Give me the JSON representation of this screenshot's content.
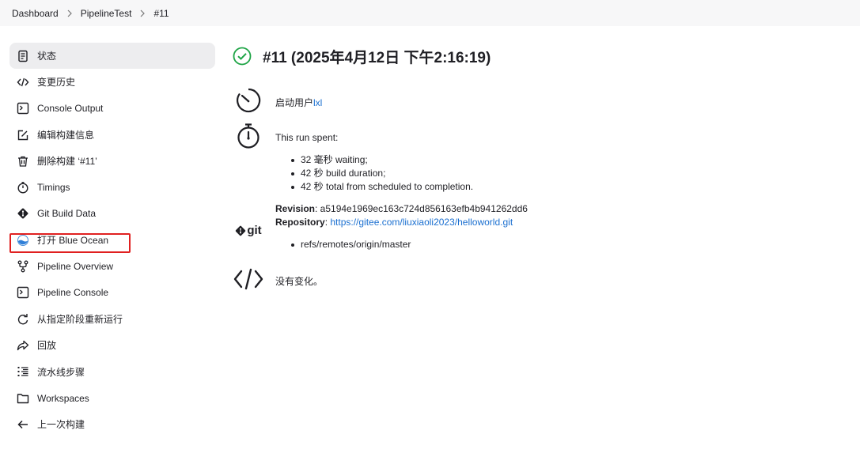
{
  "breadcrumb": {
    "items": [
      "Dashboard",
      "PipelineTest",
      "#11"
    ]
  },
  "sidebar": {
    "items": [
      {
        "label": "状态",
        "icon": "status-doc-icon"
      },
      {
        "label": "变更历史",
        "icon": "code-icon"
      },
      {
        "label": "Console Output",
        "icon": "terminal-icon"
      },
      {
        "label": "编辑构建信息",
        "icon": "edit-icon"
      },
      {
        "label": "删除构建 ‘#11’",
        "icon": "trash-icon"
      },
      {
        "label": "Timings",
        "icon": "stopwatch-icon"
      },
      {
        "label": "Git Build Data",
        "icon": "git-icon"
      },
      {
        "label": "打开 Blue Ocean",
        "icon": "blue-ocean-icon"
      },
      {
        "label": "Pipeline Overview",
        "icon": "pipeline-branch-icon"
      },
      {
        "label": "Pipeline Console",
        "icon": "terminal-icon"
      },
      {
        "label": "从指定阶段重新运行",
        "icon": "restart-icon"
      },
      {
        "label": "回放",
        "icon": "replay-icon"
      },
      {
        "label": "流水线步骤",
        "icon": "list-steps-icon"
      },
      {
        "label": "Workspaces",
        "icon": "folder-icon"
      },
      {
        "label": "上一次构建",
        "icon": "arrow-left-icon"
      }
    ]
  },
  "main": {
    "title": "#11 (2025年4月12日 下午2:16:19)",
    "started_by_prefix": "启动用户",
    "started_by_user": "lxl",
    "run_spent_label": "This run spent:",
    "run_spent": [
      "32 毫秒 waiting;",
      "42 秒 build duration;",
      "42 秒 total from scheduled to completion."
    ],
    "revision_label": "Revision",
    "revision_value": ": a5194e1969ec163c724d856163efb4b941262dd6",
    "repository_label": "Repository",
    "repository_sep": ": ",
    "repository_url": "https://gitee.com/liuxiaoli2023/helloworld.git",
    "branches": [
      "refs/remotes/origin/master"
    ],
    "git_logo_text": "git",
    "changes_text": "没有变化。"
  },
  "colors": {
    "success": "#1ea446",
    "link": "#1a6fd0",
    "highlight": "#e02020",
    "active_bg": "#ededef"
  }
}
